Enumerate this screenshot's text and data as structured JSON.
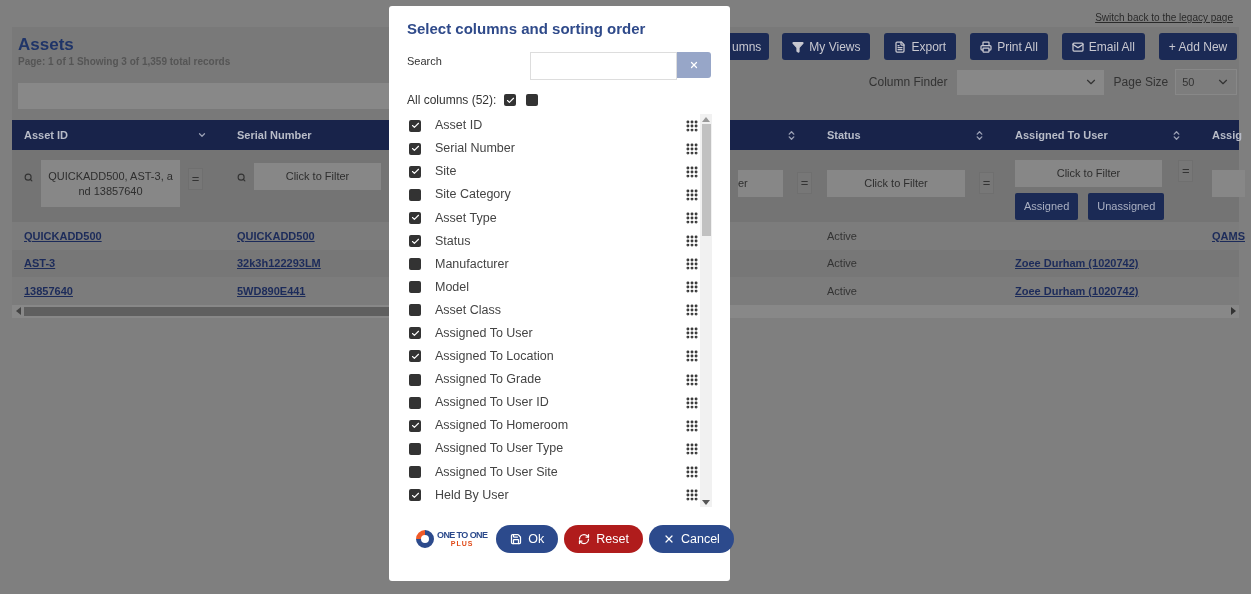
{
  "legacy_link": "Switch back to the legacy page",
  "title": "Assets",
  "page_info": "Page: **1** of **1** Showing 3 of 1,359 total records",
  "toolbar": [
    {
      "kind": "columns",
      "label": "umns"
    },
    {
      "kind": "views",
      "label": "My Views"
    },
    {
      "kind": "export",
      "label": "Export"
    },
    {
      "kind": "print",
      "label": "Print All"
    },
    {
      "kind": "email",
      "label": "Email All"
    },
    {
      "kind": "add",
      "label": "+ Add New"
    }
  ],
  "column_finder": {
    "label": "Column Finder"
  },
  "page_size": {
    "label": "Page Size",
    "value": "50"
  },
  "table": {
    "columns": [
      {
        "label": "Asset ID",
        "sorted": true,
        "filter": {
          "value": "QUICKADD500, AST-3, and 13857640",
          "operator": "="
        }
      },
      {
        "label": "Serial Number",
        "filter": {
          "placeholder": "Click to Filter"
        }
      },
      {
        "sorted": false,
        "filter": {
          "placeholder": "er",
          "operator": "="
        }
      },
      {
        "label": "Status",
        "sorted": false,
        "filter": {
          "placeholder": "Click to Filter",
          "operator": "="
        }
      },
      {
        "label": "Assigned To User",
        "sorted": false,
        "filter": {
          "placeholder": "Click to Filter",
          "operator": "="
        },
        "filter_buttons": [
          "Assigned",
          "Unassigned"
        ]
      },
      {
        "label": "Assig"
      }
    ],
    "rows": [
      {
        "asset_id": "QUICKADD500",
        "serial_number": "QUICKADD500",
        "status": "Active",
        "column_6": "QAMS"
      },
      {
        "asset_id": "AST-3",
        "serial_number": "32k3h122293LM",
        "status": "Active",
        "assigned_to_user": "Zoee Durham (1020742)"
      },
      {
        "asset_id": "13857640",
        "serial_number": "5WD890E441",
        "status": "Active",
        "assigned_to_user": "Zoee Durham (1020742)"
      }
    ]
  },
  "dialog": {
    "title": "Select columns and sorting order",
    "search": {
      "label": "Search"
    },
    "all_columns": {
      "label": "All columns (52):",
      "toggles": [
        {
          "checked": true
        },
        {
          "checked": false
        }
      ]
    },
    "columns": [
      {
        "label": "Asset ID",
        "checked": true
      },
      {
        "label": "Serial Number",
        "checked": true
      },
      {
        "label": "Site",
        "checked": true
      },
      {
        "label": "Site Category",
        "checked": false
      },
      {
        "label": "Asset Type",
        "checked": true
      },
      {
        "label": "Status",
        "checked": true
      },
      {
        "label": "Manufacturer",
        "checked": false
      },
      {
        "label": "Model",
        "checked": false
      },
      {
        "label": "Asset Class",
        "checked": false
      },
      {
        "label": "Assigned To User",
        "checked": true
      },
      {
        "label": "Assigned To Location",
        "checked": true
      },
      {
        "label": "Assigned To Grade",
        "checked": false
      },
      {
        "label": "Assigned To User ID",
        "checked": false
      },
      {
        "label": "Assigned To Homeroom",
        "checked": true
      },
      {
        "label": "Assigned To User Type",
        "checked": false
      },
      {
        "label": "Assigned To User Site",
        "checked": false
      },
      {
        "label": "Held By User",
        "checked": true
      }
    ],
    "logo": {
      "name": "ONE TO ONE",
      "tagline": "PLUS"
    },
    "buttons": [
      {
        "kind": "ok",
        "label": "Ok"
      },
      {
        "kind": "reset",
        "label": "Reset"
      },
      {
        "kind": "cancel",
        "label": "Cancel"
      }
    ]
  }
}
